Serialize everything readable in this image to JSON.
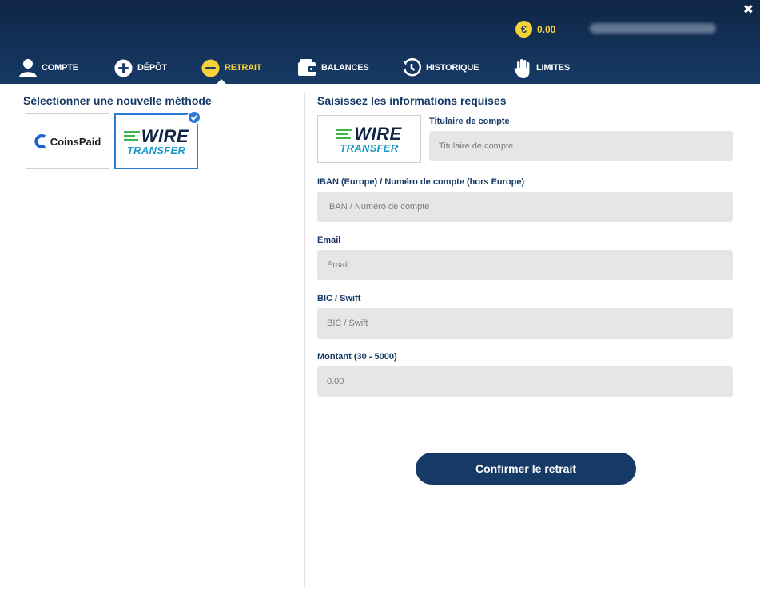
{
  "header": {
    "close_symbol": "✖",
    "balance": {
      "currency_symbol": "€",
      "value": "0.00"
    }
  },
  "nav": {
    "items": [
      {
        "id": "compte",
        "label": "COMPTE",
        "icon": "user-icon"
      },
      {
        "id": "depot",
        "label": "DÉPÔT",
        "icon": "plus-circle-icon"
      },
      {
        "id": "retrait",
        "label": "RETRAIT",
        "icon": "minus-circle-icon",
        "active": true
      },
      {
        "id": "balances",
        "label": "BALANCES",
        "icon": "wallet-icon"
      },
      {
        "id": "historique",
        "label": "HISTORIQUE",
        "icon": "history-icon"
      },
      {
        "id": "limites",
        "label": "LIMITES",
        "icon": "hand-icon"
      }
    ]
  },
  "methods": {
    "title": "Sélectionner une nouvelle méthode",
    "coinspaid": {
      "name": "CoinsPaid"
    },
    "wire": {
      "word": "WIRE",
      "sub": "TRANSFER",
      "selected": true
    }
  },
  "form": {
    "title": "Saisissez les informations requises",
    "holder": {
      "label": "Titulaire de compte",
      "placeholder": "Titulaire de compte"
    },
    "iban": {
      "label": "IBAN (Europe) / Numéro de compte (hors Europe)",
      "placeholder": "IBAN / Numéro de compte"
    },
    "email": {
      "label": "Email",
      "placeholder": "Email"
    },
    "bic": {
      "label": "BIC / Swift",
      "placeholder": "BIC / Swift"
    },
    "amount": {
      "label": "Montant (30 - 5000)",
      "placeholder": "0.00"
    },
    "confirm_label": "Confirmer le retrait"
  },
  "colors": {
    "header_dark": "#0f2545",
    "header_light": "#163a66",
    "accent_yellow": "#f3d23a",
    "selected_blue": "#2a7bd4",
    "wire_green": "#3cb64a",
    "wire_cyan": "#1a98c8"
  }
}
